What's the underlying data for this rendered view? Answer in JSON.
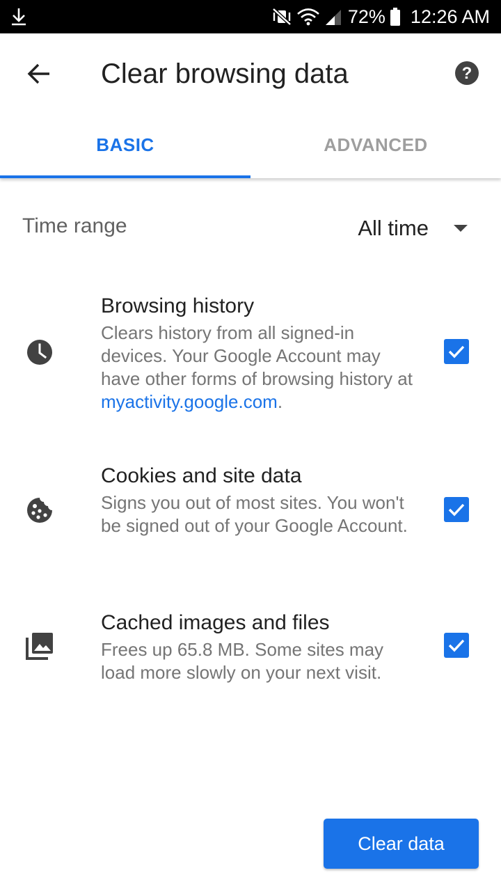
{
  "status_bar": {
    "battery_percent": "72%",
    "time": "12:26 AM",
    "icons": [
      "download-icon",
      "mute-vibrate-icon",
      "wifi-icon",
      "signal-icon",
      "battery-icon"
    ]
  },
  "app_bar": {
    "title": "Clear browsing data",
    "icons": [
      "back-arrow-icon",
      "help-icon"
    ]
  },
  "tabs": [
    {
      "label": "BASIC",
      "selected": true
    },
    {
      "label": "ADVANCED",
      "selected": false
    }
  ],
  "time_range": {
    "label": "Time range",
    "value": "All time"
  },
  "options": [
    {
      "icon": "clock-icon",
      "title": "Browsing history",
      "description": "Clears history from all signed-in devices. Your Google Account may have other forms of browsing history at ",
      "link": "myactivity.google.com",
      "description_suffix": ".",
      "checked": true
    },
    {
      "icon": "cookie-icon",
      "title": "Cookies and site data",
      "description": "Signs you out of most sites. You won't be signed out of your Google Account.",
      "checked": true
    },
    {
      "icon": "photo-library-icon",
      "title": "Cached images and files",
      "description": "Frees up 65.8 MB. Some sites may load more slowly on your next visit.",
      "checked": true
    }
  ],
  "actions": {
    "clear_label": "Clear data"
  },
  "colors": {
    "accent": "#1a73e8",
    "title_text": "#212121",
    "secondary_text": "#757575",
    "inactive_tab": "#9e9e9e"
  }
}
